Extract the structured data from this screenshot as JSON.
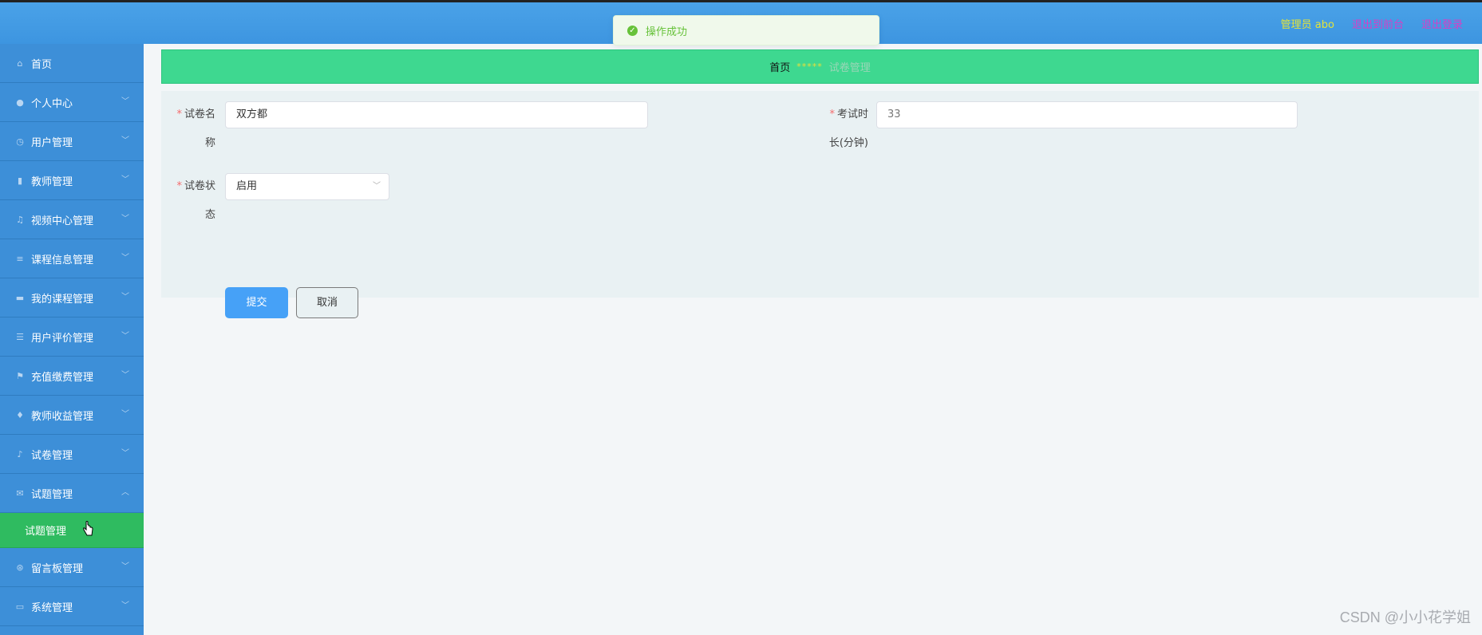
{
  "topbar": {
    "admin_label": "管理员 abo",
    "to_front_label": "退出到前台",
    "logout_label": "退出登录"
  },
  "toast": {
    "message": "操作成功"
  },
  "sidebar": {
    "items": [
      {
        "label": "首页",
        "icon": "home-icon"
      },
      {
        "label": "个人中心",
        "icon": "user-icon"
      },
      {
        "label": "用户管理",
        "icon": "clock-icon"
      },
      {
        "label": "教师管理",
        "icon": "clipboard-icon"
      },
      {
        "label": "视频中心管理",
        "icon": "bell-icon"
      },
      {
        "label": "课程信息管理",
        "icon": "menu-icon"
      },
      {
        "label": "我的课程管理",
        "icon": "ticket-icon"
      },
      {
        "label": "用户评价管理",
        "icon": "sliders-icon"
      },
      {
        "label": "充值缴费管理",
        "icon": "flag-icon"
      },
      {
        "label": "教师收益管理",
        "icon": "microphone-icon"
      },
      {
        "label": "试卷管理",
        "icon": "mic-icon"
      },
      {
        "label": "试题管理",
        "icon": "mail-icon"
      },
      {
        "label": "留言板管理",
        "icon": "globe-icon"
      },
      {
        "label": "系统管理",
        "icon": "monitor-icon"
      }
    ],
    "submenu_label": "试题管理"
  },
  "breadcrumb": {
    "home": "首页",
    "separator": "*****",
    "current": "试卷管理"
  },
  "form": {
    "name_label_1": "试卷名",
    "name_label_2": "称",
    "name_value": "双方都",
    "duration_label_1": "考试时",
    "duration_label_2": "长(分钟)",
    "duration_value": "33",
    "status_label_1": "试卷状",
    "status_label_2": "态",
    "status_value": "启用",
    "required_mark": "*",
    "submit_label": "提交",
    "cancel_label": "取消"
  },
  "watermark": "CSDN @小小花学姐",
  "colors": {
    "topbar": "#4aa2e8",
    "sidebar": "#3d8fd8",
    "active_submenu": "#2fbb60",
    "breadcrumb_bar": "#3ed890",
    "primary_button": "#46a1f7",
    "success": "#67c23a"
  }
}
